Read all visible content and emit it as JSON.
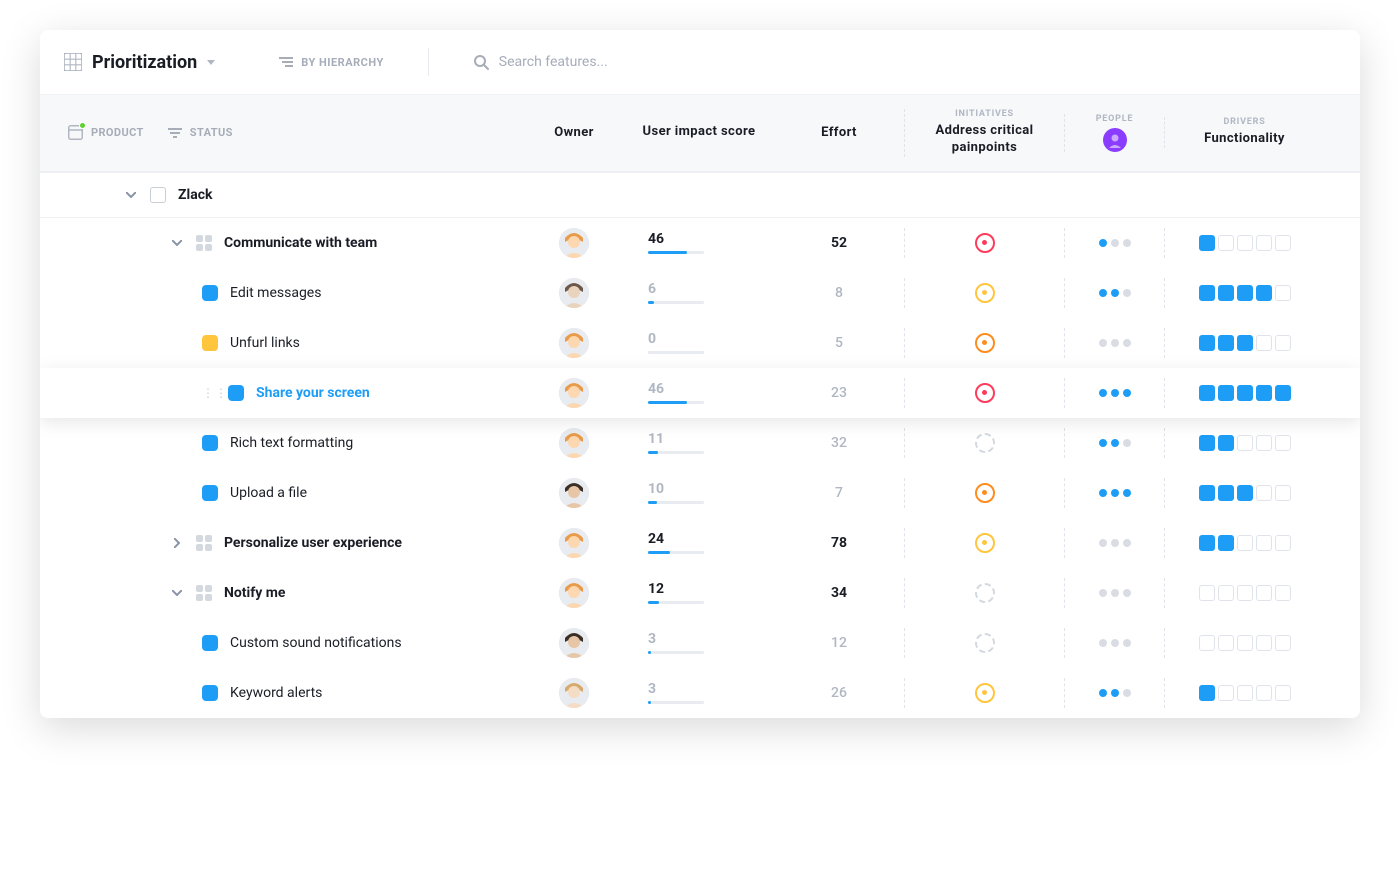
{
  "header": {
    "view_title": "Prioritization",
    "by_hierarchy": "BY HIERARCHY",
    "search_placeholder": "Search features..."
  },
  "columns": {
    "product": "PRODUCT",
    "status": "STATUS",
    "owner": "Owner",
    "impact": "User impact score",
    "effort": "Effort",
    "initiatives_super": "INITIATIVES",
    "initiatives_sub": "Address critical painpoints",
    "people_super": "PEOPLE",
    "drivers_super": "DRIVERS",
    "drivers_sub": "Functionality"
  },
  "product_name": "Zlack",
  "rows": [
    {
      "id": "communicate",
      "level": 2,
      "type": "group",
      "expanded": true,
      "name": "Communicate with team",
      "owner": "a",
      "impact": 46,
      "impact_bold": true,
      "impact_pct": 70,
      "effort": 52,
      "effort_bold": true,
      "init": "red",
      "people": 1,
      "driver": 1
    },
    {
      "id": "edit-messages",
      "level": 3,
      "type": "item",
      "color": "blue",
      "name": "Edit messages",
      "owner": "b",
      "impact": 6,
      "impact_pct": 10,
      "effort": 8,
      "init": "yellow",
      "people": 2,
      "driver": 4
    },
    {
      "id": "unfurl-links",
      "level": 3,
      "type": "item",
      "color": "yellow",
      "name": "Unfurl links",
      "owner": "a",
      "impact": 0,
      "impact_pct": 0,
      "effort": 5,
      "init": "orange",
      "people": 0,
      "driver": 3
    },
    {
      "id": "share-screen",
      "level": 3,
      "type": "item",
      "color": "blue",
      "name": "Share your screen",
      "owner": "a",
      "impact": 46,
      "impact_pct": 70,
      "effort": 23,
      "init": "red",
      "people": 3,
      "driver": 5,
      "selected": true
    },
    {
      "id": "rich-text",
      "level": 3,
      "type": "item",
      "color": "blue",
      "name": "Rich text formatting",
      "owner": "a",
      "impact": 11,
      "impact_pct": 18,
      "effort": 32,
      "init": "empty",
      "people": 2,
      "driver": 2
    },
    {
      "id": "upload-file",
      "level": 3,
      "type": "item",
      "color": "blue",
      "name": "Upload a file",
      "owner": "c",
      "impact": 10,
      "impact_pct": 16,
      "effort": 7,
      "init": "orange",
      "people": 3,
      "driver": 3
    },
    {
      "id": "personalize",
      "level": 2,
      "type": "group",
      "expanded": false,
      "name": "Personalize user experience",
      "owner": "a",
      "impact": 24,
      "impact_bold": true,
      "impact_pct": 40,
      "effort": 78,
      "effort_bold": true,
      "init": "yellow",
      "people": 0,
      "driver": 2
    },
    {
      "id": "notify-me",
      "level": 2,
      "type": "group",
      "expanded": true,
      "name": "Notify me",
      "owner": "a",
      "impact": 12,
      "impact_bold": true,
      "impact_pct": 20,
      "effort": 34,
      "effort_bold": true,
      "init": "empty",
      "people": 0,
      "driver": 0
    },
    {
      "id": "custom-sound",
      "level": 3,
      "type": "item",
      "color": "blue",
      "name": "Custom sound notifications",
      "owner": "c",
      "impact": 3,
      "impact_pct": 5,
      "effort": 12,
      "init": "empty",
      "people": 0,
      "driver": 0
    },
    {
      "id": "keyword-alerts",
      "level": 3,
      "type": "item",
      "color": "blue",
      "name": "Keyword alerts",
      "owner": "d",
      "impact": 3,
      "impact_pct": 5,
      "effort": 26,
      "init": "yellow",
      "people": 2,
      "driver": 1
    }
  ]
}
